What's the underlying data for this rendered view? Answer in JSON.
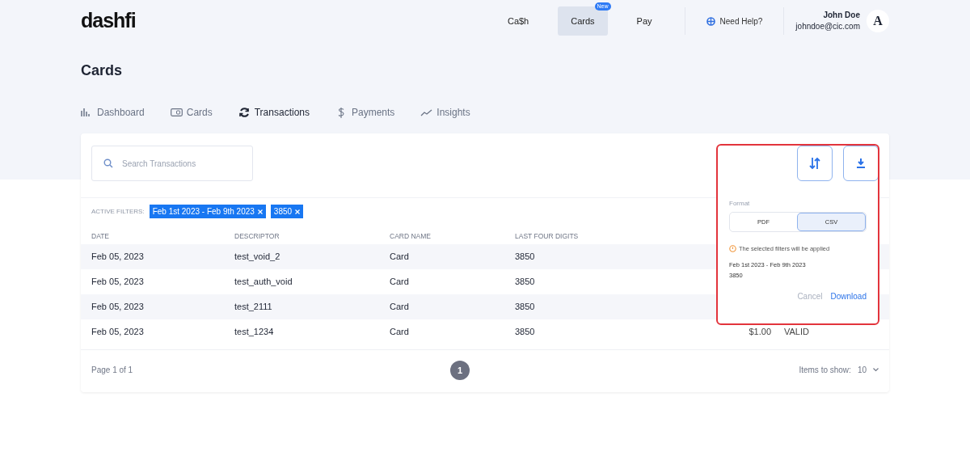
{
  "header": {
    "logo": "dashfi",
    "nav": [
      {
        "label": "Ca$h",
        "selected": false
      },
      {
        "label": "Cards",
        "selected": true,
        "badge": "New"
      },
      {
        "label": "Pay",
        "selected": false
      }
    ],
    "help": "Need Help?",
    "user": {
      "name": "John Doe",
      "email": "johndoe@cic.com",
      "avatar": "A"
    }
  },
  "page_title": "Cards",
  "tabs": [
    {
      "label": "Dashboard",
      "kind": "dashboard",
      "selected": false
    },
    {
      "label": "Cards",
      "kind": "cards",
      "selected": false
    },
    {
      "label": "Transactions",
      "kind": "transactions",
      "selected": true
    },
    {
      "label": "Payments",
      "kind": "payments",
      "selected": false
    },
    {
      "label": "Insights",
      "kind": "insights",
      "selected": false
    }
  ],
  "search": {
    "placeholder": "Search Transactions"
  },
  "active_filters": {
    "label": "ACTIVE FILTERS:",
    "chips": [
      "Feb 1st 2023 - Feb 9th 2023",
      "3850"
    ]
  },
  "table": {
    "columns": [
      "DATE",
      "DESCRIPTOR",
      "CARD NAME",
      "LAST FOUR DIGITS"
    ],
    "rows": [
      {
        "cells": [
          "Feb 05, 2023",
          "test_void_2",
          "Card",
          "3850"
        ]
      },
      {
        "cells": [
          "Feb 05, 2023",
          "test_auth_void",
          "Card",
          "3850"
        ]
      },
      {
        "cells": [
          "Feb 05, 2023",
          "test_2111",
          "Card",
          "3850"
        ]
      },
      {
        "cells": [
          "Feb 05, 2023",
          "test_1234",
          "Card",
          "3850"
        ],
        "column_5": "$1.00",
        "column_6": "VALID"
      }
    ]
  },
  "footer": {
    "page_info": "Page 1 of 1",
    "pages": [
      {
        "label": "1",
        "selected": true
      }
    ],
    "items_label": "Items to show:",
    "items_value": "10"
  },
  "export_popup": {
    "format_label": "Format",
    "formats": [
      {
        "label": "PDF",
        "selected": false
      },
      {
        "label": "CSV",
        "selected": true
      }
    ],
    "notice": "The selected filters will be applied",
    "filters": [
      "Feb 1st 2023 - Feb 9th 2023",
      "3850"
    ],
    "cancel": "Cancel",
    "download": "Download"
  }
}
